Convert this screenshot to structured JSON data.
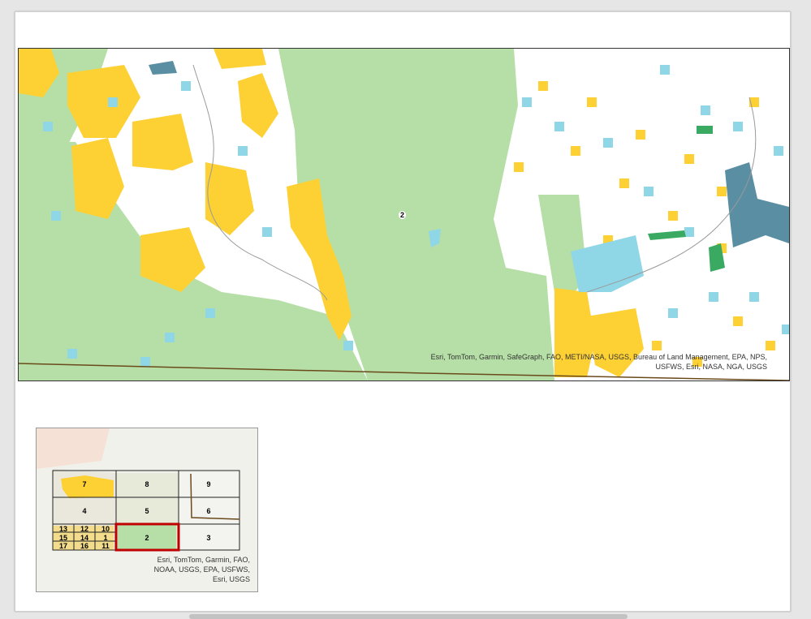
{
  "map": {
    "label": "2",
    "attribution": "Esri, TomTom, Garmin, SafeGraph, FAO, METI/NASA, USGS, Bureau of Land Management, EPA, NPS, USFWS, Esri, NASA, NGA, USGS"
  },
  "overview": {
    "selected_tile": "2",
    "tiles": [
      "7",
      "8",
      "9",
      "4",
      "5",
      "6",
      "13",
      "12",
      "10",
      "15",
      "14",
      "1",
      "17",
      "16",
      "11",
      "2",
      "3"
    ],
    "attribution": "Esri, TomTom, Garmin, FAO, NOAA, USGS, EPA, USFWS, Esri, USGS"
  },
  "colors": {
    "state_land": "#b5dfa6",
    "yellow_parcels": "#fdd034",
    "blue_parcels": "#8fd6e7",
    "dark_parcels": "#5a8ea3",
    "green_parcels": "#3aaa63",
    "selected_outline": "#c00000"
  }
}
